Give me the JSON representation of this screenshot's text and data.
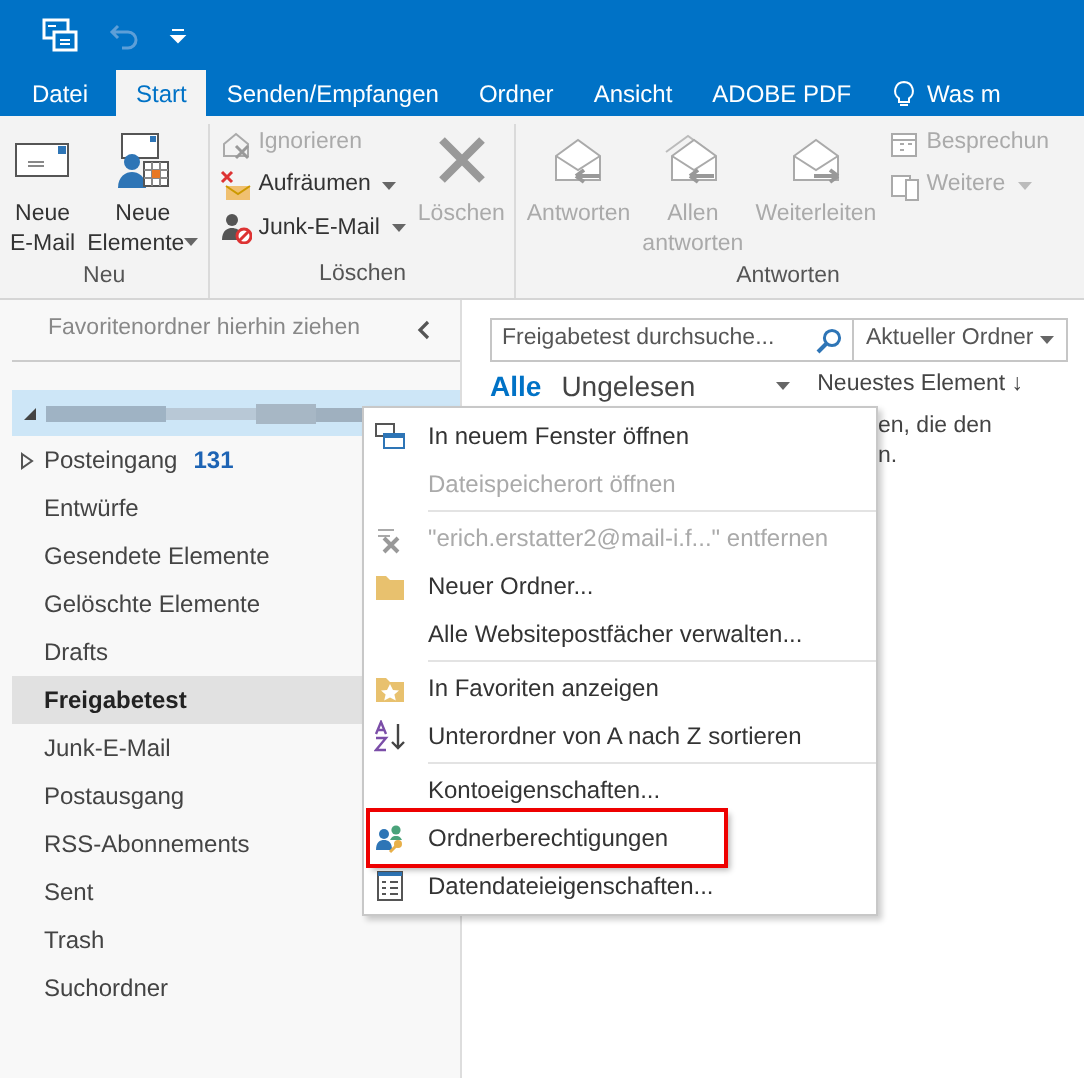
{
  "quick_access": {
    "undo": {
      "disabled": true
    }
  },
  "tabs": [
    {
      "label": "Datei",
      "selected": false
    },
    {
      "label": "Start",
      "selected": true
    },
    {
      "label": "Senden/Empfangen",
      "selected": false
    },
    {
      "label": "Ordner",
      "selected": false
    },
    {
      "label": "Ansicht",
      "selected": false
    },
    {
      "label": "ADOBE PDF",
      "selected": false
    },
    {
      "label": "Was m",
      "selected": false,
      "kind": "tell"
    }
  ],
  "ribbon": [
    {
      "label": "Neu",
      "items": [
        {
          "kind": "large",
          "lines": [
            "Neue",
            "E-Mail"
          ],
          "dropdown": false,
          "disabled": false
        },
        {
          "kind": "large",
          "lines": [
            "Neue",
            "Elemente"
          ],
          "dropdown": true,
          "disabled": false
        }
      ]
    },
    {
      "label": "Löschen",
      "items": [
        {
          "kind": "stack",
          "children": [
            {
              "label": "Ignorieren",
              "dropdown": false,
              "disabled": true
            },
            {
              "label": "Aufräumen",
              "dropdown": true,
              "disabled": false
            },
            {
              "label": "Junk-E-Mail",
              "dropdown": true,
              "disabled": false
            }
          ]
        },
        {
          "kind": "large",
          "lines": [
            "Löschen"
          ],
          "dropdown": false,
          "disabled": true
        }
      ]
    },
    {
      "label": "Antworten",
      "items": [
        {
          "kind": "large",
          "lines": [
            "Antworten"
          ],
          "dropdown": false,
          "disabled": true
        },
        {
          "kind": "large",
          "lines": [
            "Allen",
            "antworten"
          ],
          "dropdown": false,
          "disabled": true
        },
        {
          "kind": "large",
          "lines": [
            "Weiterleiten"
          ],
          "dropdown": false,
          "disabled": true
        },
        {
          "kind": "stack",
          "children": [
            {
              "label": "Besprechun",
              "dropdown": false,
              "disabled": true
            },
            {
              "label": "Weitere",
              "dropdown": true,
              "disabled": true
            }
          ]
        }
      ]
    }
  ],
  "favorites_hint": "Favoritenordner hierhin ziehen",
  "account": {
    "expanded": true
  },
  "folders": [
    {
      "label": "Posteingang",
      "count": "131",
      "expandable": true,
      "selected": false
    },
    {
      "label": "Entwürfe",
      "expandable": false,
      "selected": false
    },
    {
      "label": "Gesendete Elemente",
      "expandable": false,
      "selected": false
    },
    {
      "label": "Gelöschte Elemente",
      "expandable": false,
      "selected": false
    },
    {
      "label": "Drafts",
      "expandable": false,
      "selected": false
    },
    {
      "label": "Freigabetest",
      "expandable": false,
      "selected": true
    },
    {
      "label": "Junk-E-Mail",
      "expandable": false,
      "selected": false
    },
    {
      "label": "Postausgang",
      "expandable": false,
      "selected": false
    },
    {
      "label": "RSS-Abonnements",
      "expandable": false,
      "selected": false
    },
    {
      "label": "Sent",
      "expandable": false,
      "selected": false
    },
    {
      "label": "Trash",
      "expandable": false,
      "selected": false
    },
    {
      "label": "Suchordner",
      "expandable": false,
      "selected": false
    }
  ],
  "search": {
    "placeholder": "Freigabetest durchsuche...",
    "scope": "Aktueller Ordner"
  },
  "filters": [
    {
      "label": "Alle",
      "selected": true
    },
    {
      "label": "Ungelesen",
      "selected": false
    }
  ],
  "sort": "Neuestes Element ↓",
  "empty_message": [
    "en, die den",
    "n."
  ],
  "context_menu": [
    {
      "kind": "window",
      "label": "In neuem Fenster öffnen",
      "disabled": false,
      "highlighted": false
    },
    {
      "kind": "plain",
      "label": "Dateispeicherort öffnen",
      "disabled": true,
      "highlighted": false
    },
    {
      "kind": "separator"
    },
    {
      "kind": "remove",
      "label": "\"erich.erstatter2@mail-i.f...\" entfernen",
      "disabled": true,
      "highlighted": false
    },
    {
      "kind": "folder",
      "label": "Neuer Ordner...",
      "disabled": false,
      "highlighted": false
    },
    {
      "kind": "plain",
      "label": "Alle Websitepostfächer verwalten...",
      "disabled": false,
      "highlighted": false
    },
    {
      "kind": "separator"
    },
    {
      "kind": "favorite",
      "label": "In Favoriten anzeigen",
      "disabled": false,
      "highlighted": false
    },
    {
      "kind": "sort",
      "label": "Unterordner von A nach Z sortieren",
      "disabled": false,
      "highlighted": false
    },
    {
      "kind": "separator"
    },
    {
      "kind": "plain",
      "label": "Kontoeigenschaften...",
      "disabled": false,
      "highlighted": false
    },
    {
      "kind": "permissions",
      "label": "Ordnerberechtigungen",
      "disabled": false,
      "highlighted": true
    },
    {
      "kind": "properties",
      "label": "Datendateieigenschaften...",
      "disabled": false,
      "highlighted": false
    }
  ]
}
